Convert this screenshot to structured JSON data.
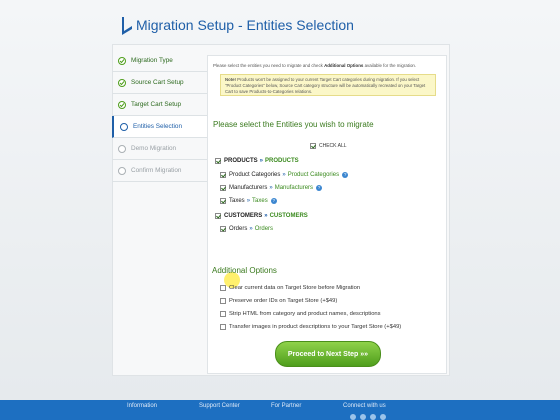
{
  "header": {
    "title": "Migration Setup - Entities Selection"
  },
  "nav": {
    "items": [
      {
        "label": "Migration Type",
        "state": "done"
      },
      {
        "label": "Source Cart Setup",
        "state": "done"
      },
      {
        "label": "Target Cart Setup",
        "state": "done"
      },
      {
        "label": "Entities Selection",
        "state": "active"
      },
      {
        "label": "Demo Migration",
        "state": "disabled"
      },
      {
        "label": "Confirm Migration",
        "state": "disabled"
      }
    ]
  },
  "main": {
    "intro_prefix": "Please select the entities you need to migrate and check ",
    "intro_bold": "Additional Options",
    "intro_suffix": " available for the migration.",
    "note_label": "Note!",
    "note_text": " Products won't be assigned to your current Target Cart categories during migration. If you select \"Product Categories\" below, Source Cart category structure will be automatically recreated on your Target Cart to save Products-to-Categories relations.",
    "section_title": "Please select the Entities you wish to migrate",
    "check_all": "CHECK ALL",
    "separator": "»",
    "entities": {
      "products": {
        "source": "PRODUCTS",
        "target": "PRODUCTS",
        "children": [
          {
            "source": "Product Categories",
            "target": "Product Categories",
            "help": true
          },
          {
            "source": "Manufacturers",
            "target": "Manufacturers",
            "help": true
          },
          {
            "source": "Taxes",
            "target": "Taxes",
            "help": true
          }
        ]
      },
      "customers": {
        "source": "CUSTOMERS",
        "target": "CUSTOMERS",
        "children": [
          {
            "source": "Orders",
            "target": "Orders",
            "help": false
          }
        ]
      }
    },
    "additional_title": "Additional Options",
    "options": [
      {
        "label": "Clear current data on Target Store before Migration",
        "checked": false
      },
      {
        "label": "Preserve order IDs on Target Store (+$49)",
        "checked": false
      },
      {
        "label": "Strip HTML from category and product names, descriptions",
        "checked": false
      },
      {
        "label": "Transfer images in product descriptions to your Target Store (+$49)",
        "checked": false
      }
    ],
    "proceed_label": "Proceed to Next Step »»"
  },
  "footer": {
    "links": [
      "Information",
      "Support Center",
      "For Partner",
      "Connect with us"
    ]
  },
  "colors": {
    "accent": "#1f5fa8",
    "green": "#3a8a1e",
    "footer": "#1d6fc1",
    "button": "#5aa824"
  },
  "icons": {
    "done": "check-circle-icon",
    "active": "empty-circle-icon",
    "disabled": "empty-circle-icon"
  }
}
